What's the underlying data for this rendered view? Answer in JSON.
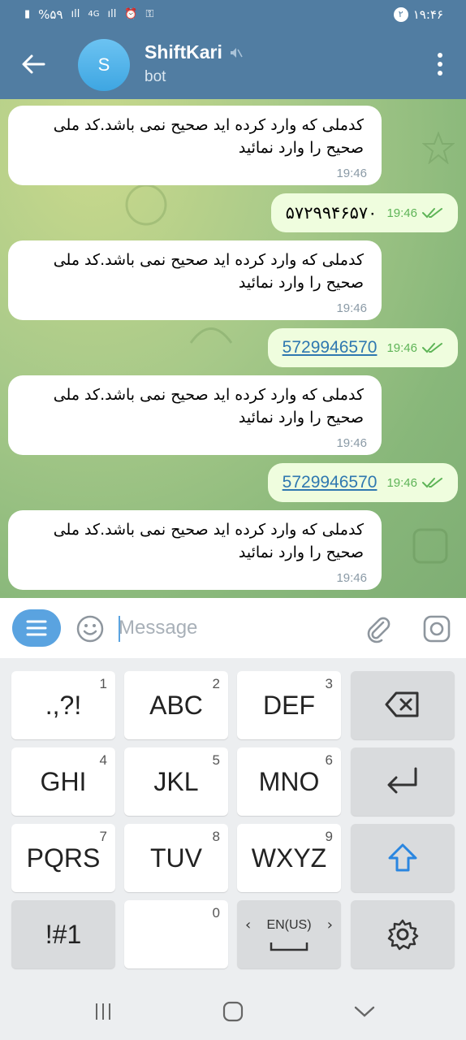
{
  "status_bar": {
    "battery": "%۵۹",
    "network": "4G",
    "sim_badge": "۲",
    "time": "۱۹:۴۶"
  },
  "header": {
    "avatar_letter": "S",
    "title": "ShiftKari",
    "subtitle": "bot"
  },
  "messages": [
    {
      "type": "in",
      "text": "کدملی که وارد کرده اید صحیح نمی باشد.کد ملی صحیح را وارد نمائید",
      "time": "19:46"
    },
    {
      "type": "out",
      "text": "۵۷۲۹۹۴۶۵۷۰",
      "time": "19:46",
      "link": false
    },
    {
      "type": "in",
      "text": "کدملی که وارد کرده اید صحیح نمی باشد.کد ملی صحیح را وارد نمائید",
      "time": "19:46"
    },
    {
      "type": "out",
      "text": "5729946570",
      "time": "19:46",
      "link": true
    },
    {
      "type": "in",
      "text": "کدملی که وارد کرده اید صحیح نمی باشد.کد ملی صحیح را وارد نمائید",
      "time": "19:46"
    },
    {
      "type": "out",
      "text": "5729946570",
      "time": "19:46",
      "link": true
    },
    {
      "type": "in",
      "text": "کدملی که وارد کرده اید صحیح نمی باشد.کد ملی صحیح را وارد نمائید",
      "time": "19:46"
    }
  ],
  "input": {
    "placeholder": "Message",
    "value": ""
  },
  "keyboard": {
    "keys": [
      {
        "main": ".,?!",
        "sub": "1"
      },
      {
        "main": "ABC",
        "sub": "2"
      },
      {
        "main": "DEF",
        "sub": "3"
      },
      {
        "main": "GHI",
        "sub": "4"
      },
      {
        "main": "JKL",
        "sub": "5"
      },
      {
        "main": "MNO",
        "sub": "6"
      },
      {
        "main": "PQRS",
        "sub": "7"
      },
      {
        "main": "TUV",
        "sub": "8"
      },
      {
        "main": "WXYZ",
        "sub": "9"
      },
      {
        "main": "!#1",
        "sub": ""
      },
      {
        "main": "",
        "sub": "0"
      },
      {
        "main": "EN(US)",
        "sub": ""
      }
    ]
  },
  "colors": {
    "header": "#517da2",
    "accent": "#5aa3e0",
    "out_bubble": "#effdde",
    "check": "#5eb457",
    "link": "#2f78b0"
  }
}
